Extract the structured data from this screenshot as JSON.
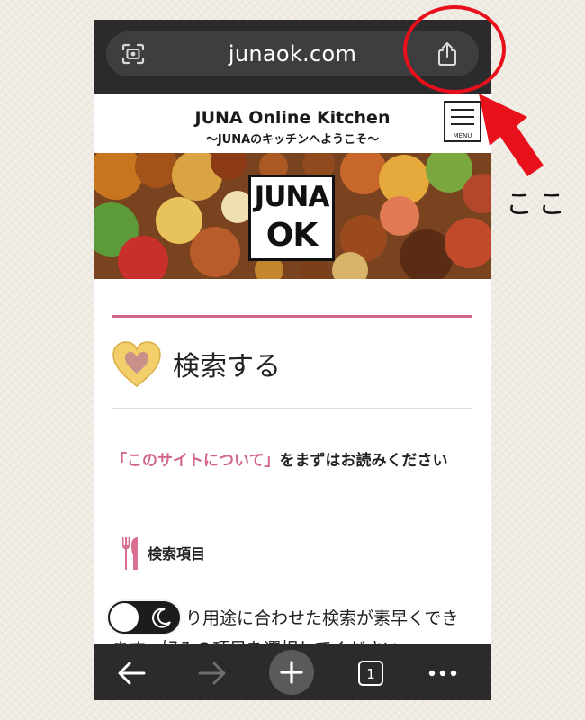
{
  "browser": {
    "url": "junaok.com",
    "scan_icon": "camera-scan-icon",
    "share_icon": "share-icon",
    "tab_count": "1",
    "nav_icons": [
      "back-arrow-icon",
      "forward-arrow-icon",
      "plus-icon",
      "tabs-icon",
      "more-icon"
    ]
  },
  "site": {
    "title": "JUNA Online Kitchen",
    "subtitle": "〜JUNAのキッチンへようこそ〜",
    "menu_label": "MENU",
    "logo_top": "JUNA",
    "logo_bottom": "OK"
  },
  "content": {
    "section_title": "検索する",
    "intro_link": "「このサイトについて」",
    "intro_rest": "をまずはお読みください",
    "subheading": "検索項目",
    "body_line1": "り用途に合わせた検索が素早くでき",
    "body_line2": "ます。好みの項目を選択してください。"
  },
  "annotation": {
    "label": "ここ",
    "color": "#e8101b"
  },
  "colors": {
    "accent_pink": "#d1668d",
    "browser_bar": "#2b2b2d",
    "heart": "#f2cf6a"
  }
}
